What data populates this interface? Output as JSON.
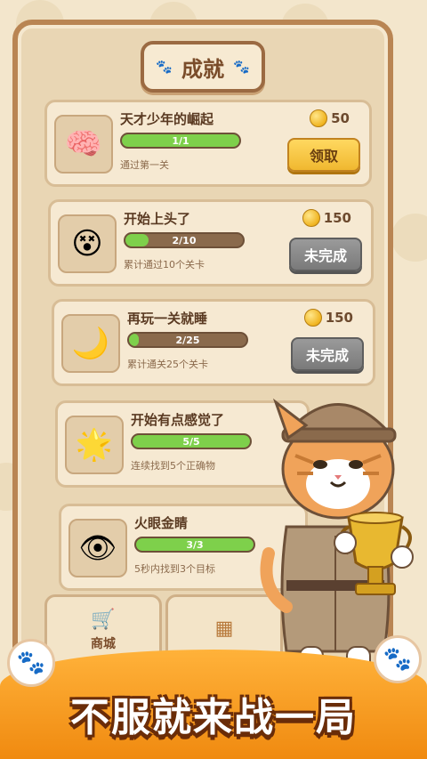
{
  "title": "成就",
  "achievements": [
    {
      "name": "天才少年的崛起",
      "progress_text": "1/1",
      "progress": 1.0,
      "desc": "通过第一关",
      "reward": "50",
      "button": "领取",
      "state": "claim",
      "badge_icon": "brain-crown-icon"
    },
    {
      "name": "开始上头了",
      "progress_text": "2/10",
      "progress": 0.2,
      "desc": "累计通过10个关卡",
      "reward": "150",
      "button": "未完成",
      "state": "undone",
      "badge_icon": "dazed-head-icon"
    },
    {
      "name": "再玩一关就睡",
      "progress_text": "2/25",
      "progress": 0.08,
      "desc": "累计通关25个关卡",
      "reward": "150",
      "button": "未完成",
      "state": "undone",
      "badge_icon": "sleeping-moon-icon"
    },
    {
      "name": "开始有点感觉了",
      "progress_text": "5/5",
      "progress": 1.0,
      "desc": "连续找到5个正确物",
      "badge_icon": "smiling-kid-icon"
    },
    {
      "name": "火眼金睛",
      "progress_text": "3/3",
      "progress": 1.0,
      "desc": "5秒内找到3个目标",
      "badge_icon": "golden-eye-icon"
    }
  ],
  "tabs": [
    {
      "label": "商城",
      "icon": "cart-icon"
    },
    {
      "label": "",
      "icon": "grid-icon"
    }
  ],
  "banner_text": "不服就来战一局",
  "colors": {
    "progress": "#7ed04b",
    "claim": "#f0b830",
    "undone": "#8a8a8a",
    "banner": "#f08a10"
  }
}
